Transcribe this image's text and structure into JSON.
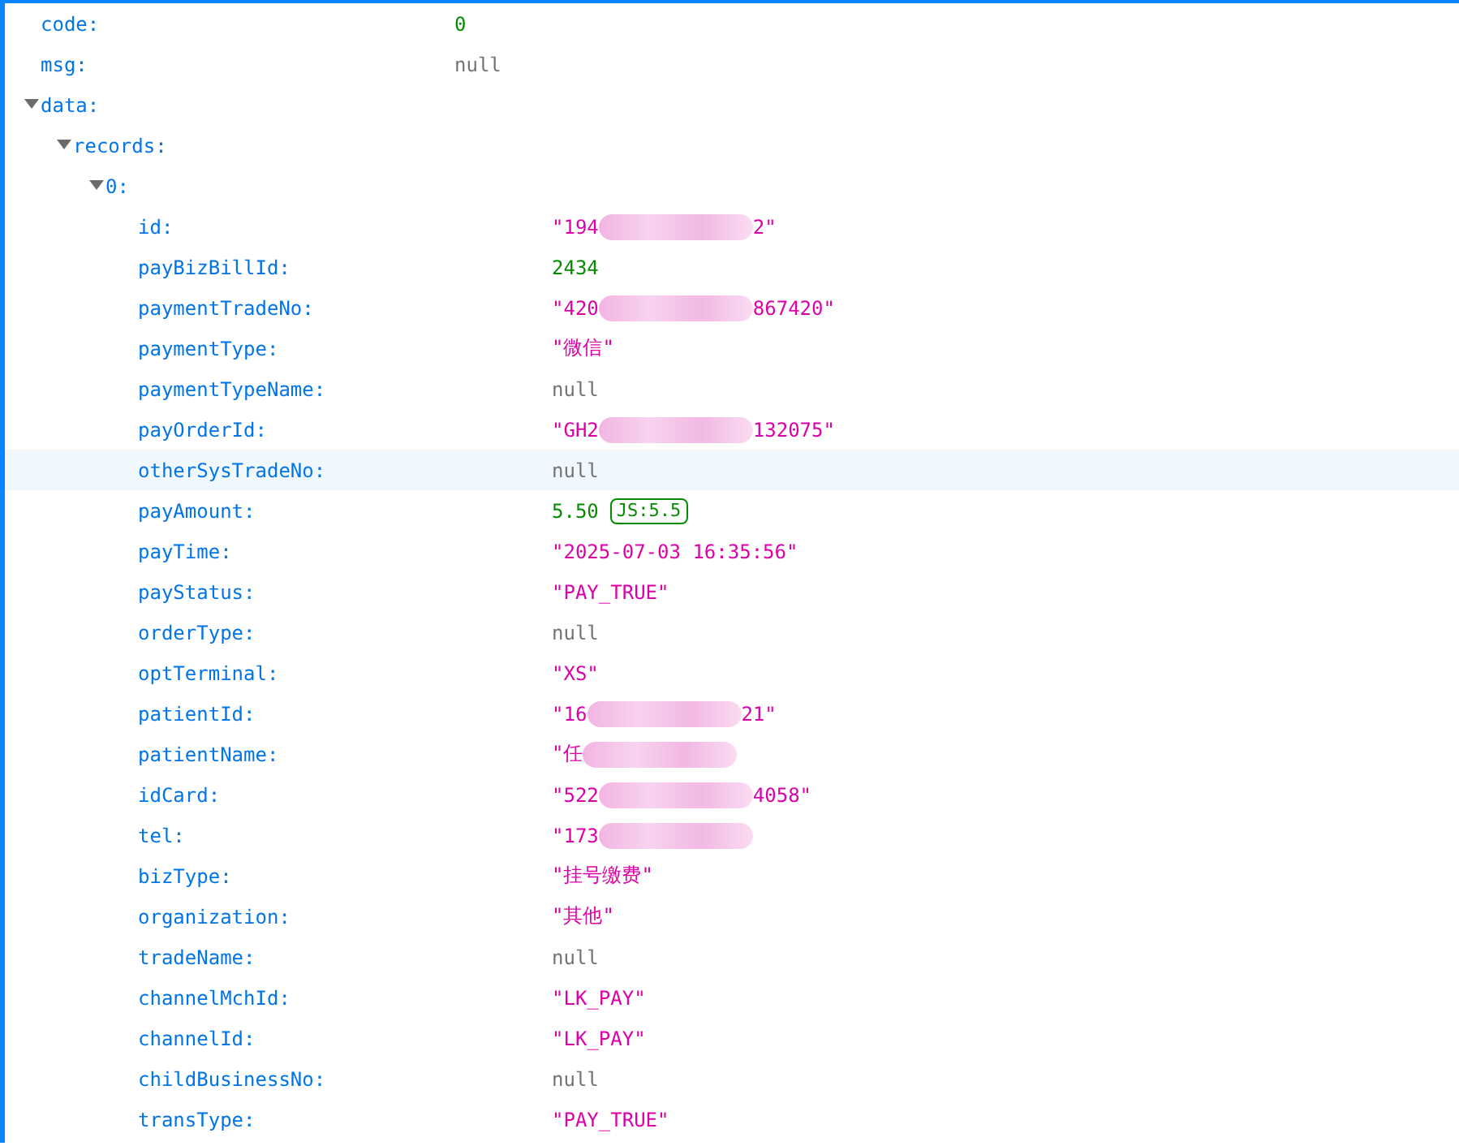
{
  "tree": [
    {
      "key": "code:",
      "value": {
        "kind": "number",
        "segments": [
          {
            "kind": "text",
            "text": "0"
          }
        ]
      }
    },
    {
      "key": "msg:",
      "value": {
        "kind": "null",
        "segments": [
          {
            "kind": "text",
            "text": "null"
          }
        ]
      }
    },
    {
      "key": "data:",
      "expanded": true,
      "children": [
        {
          "key": "records:",
          "expanded": true,
          "children": [
            {
              "key": "0:",
              "expanded": true,
              "children": [
                {
                  "key": "id:",
                  "value": {
                    "kind": "string",
                    "segments": [
                      {
                        "kind": "text",
                        "text": "\"194"
                      },
                      {
                        "kind": "blur"
                      },
                      {
                        "kind": "text",
                        "text": "2\""
                      }
                    ]
                  }
                },
                {
                  "key": "payBizBillId:",
                  "value": {
                    "kind": "number",
                    "segments": [
                      {
                        "kind": "text",
                        "text": "2434"
                      }
                    ]
                  }
                },
                {
                  "key": "paymentTradeNo:",
                  "value": {
                    "kind": "string",
                    "segments": [
                      {
                        "kind": "text",
                        "text": "\"420"
                      },
                      {
                        "kind": "blur"
                      },
                      {
                        "kind": "text",
                        "text": "867420\""
                      }
                    ]
                  }
                },
                {
                  "key": "paymentType:",
                  "value": {
                    "kind": "string",
                    "segments": [
                      {
                        "kind": "text",
                        "text": "\"微信\""
                      }
                    ]
                  }
                },
                {
                  "key": "paymentTypeName:",
                  "value": {
                    "kind": "null",
                    "segments": [
                      {
                        "kind": "text",
                        "text": "null"
                      }
                    ]
                  }
                },
                {
                  "key": "payOrderId:",
                  "value": {
                    "kind": "string",
                    "segments": [
                      {
                        "kind": "text",
                        "text": "\"GH2"
                      },
                      {
                        "kind": "blur"
                      },
                      {
                        "kind": "text",
                        "text": "132075\""
                      }
                    ]
                  }
                },
                {
                  "key": "otherSysTradeNo:",
                  "highlighted": true,
                  "value": {
                    "kind": "null",
                    "segments": [
                      {
                        "kind": "text",
                        "text": "null"
                      }
                    ]
                  }
                },
                {
                  "key": "payAmount:",
                  "value": {
                    "kind": "number",
                    "segments": [
                      {
                        "kind": "text",
                        "text": "5.50"
                      }
                    ],
                    "badge": "JS:5.5"
                  }
                },
                {
                  "key": "payTime:",
                  "value": {
                    "kind": "string",
                    "segments": [
                      {
                        "kind": "text",
                        "text": "\"2025-07-03 16:35:56\""
                      }
                    ]
                  }
                },
                {
                  "key": "payStatus:",
                  "value": {
                    "kind": "string",
                    "segments": [
                      {
                        "kind": "text",
                        "text": "\"PAY_TRUE\""
                      }
                    ]
                  }
                },
                {
                  "key": "orderType:",
                  "value": {
                    "kind": "null",
                    "segments": [
                      {
                        "kind": "text",
                        "text": "null"
                      }
                    ]
                  }
                },
                {
                  "key": "optTerminal:",
                  "value": {
                    "kind": "string",
                    "segments": [
                      {
                        "kind": "text",
                        "text": "\"XS\""
                      }
                    ]
                  }
                },
                {
                  "key": "patientId:",
                  "value": {
                    "kind": "string",
                    "segments": [
                      {
                        "kind": "text",
                        "text": "\"16"
                      },
                      {
                        "kind": "blur"
                      },
                      {
                        "kind": "text",
                        "text": "21\""
                      }
                    ]
                  }
                },
                {
                  "key": "patientName:",
                  "value": {
                    "kind": "string",
                    "segments": [
                      {
                        "kind": "text",
                        "text": "\"任"
                      },
                      {
                        "kind": "blur"
                      }
                    ]
                  }
                },
                {
                  "key": "idCard:",
                  "value": {
                    "kind": "string",
                    "segments": [
                      {
                        "kind": "text",
                        "text": "\"522"
                      },
                      {
                        "kind": "blur"
                      },
                      {
                        "kind": "text",
                        "text": "4058\""
                      }
                    ]
                  }
                },
                {
                  "key": "tel:",
                  "value": {
                    "kind": "string",
                    "segments": [
                      {
                        "kind": "text",
                        "text": "\"173"
                      },
                      {
                        "kind": "blur"
                      }
                    ]
                  }
                },
                {
                  "key": "bizType:",
                  "value": {
                    "kind": "string",
                    "segments": [
                      {
                        "kind": "text",
                        "text": "\"挂号缴费\""
                      }
                    ]
                  }
                },
                {
                  "key": "organization:",
                  "value": {
                    "kind": "string",
                    "segments": [
                      {
                        "kind": "text",
                        "text": "\"其他\""
                      }
                    ]
                  }
                },
                {
                  "key": "tradeName:",
                  "value": {
                    "kind": "null",
                    "segments": [
                      {
                        "kind": "text",
                        "text": "null"
                      }
                    ]
                  }
                },
                {
                  "key": "channelMchId:",
                  "value": {
                    "kind": "string",
                    "segments": [
                      {
                        "kind": "text",
                        "text": "\"LK_PAY\""
                      }
                    ]
                  }
                },
                {
                  "key": "channelId:",
                  "value": {
                    "kind": "string",
                    "segments": [
                      {
                        "kind": "text",
                        "text": "\"LK_PAY\""
                      }
                    ]
                  }
                },
                {
                  "key": "childBusinessNo:",
                  "value": {
                    "kind": "null",
                    "segments": [
                      {
                        "kind": "text",
                        "text": "null"
                      }
                    ]
                  }
                },
                {
                  "key": "transType:",
                  "value": {
                    "kind": "string",
                    "segments": [
                      {
                        "kind": "text",
                        "text": "\"PAY_TRUE\""
                      }
                    ]
                  }
                }
              ]
            }
          ]
        }
      ]
    }
  ]
}
